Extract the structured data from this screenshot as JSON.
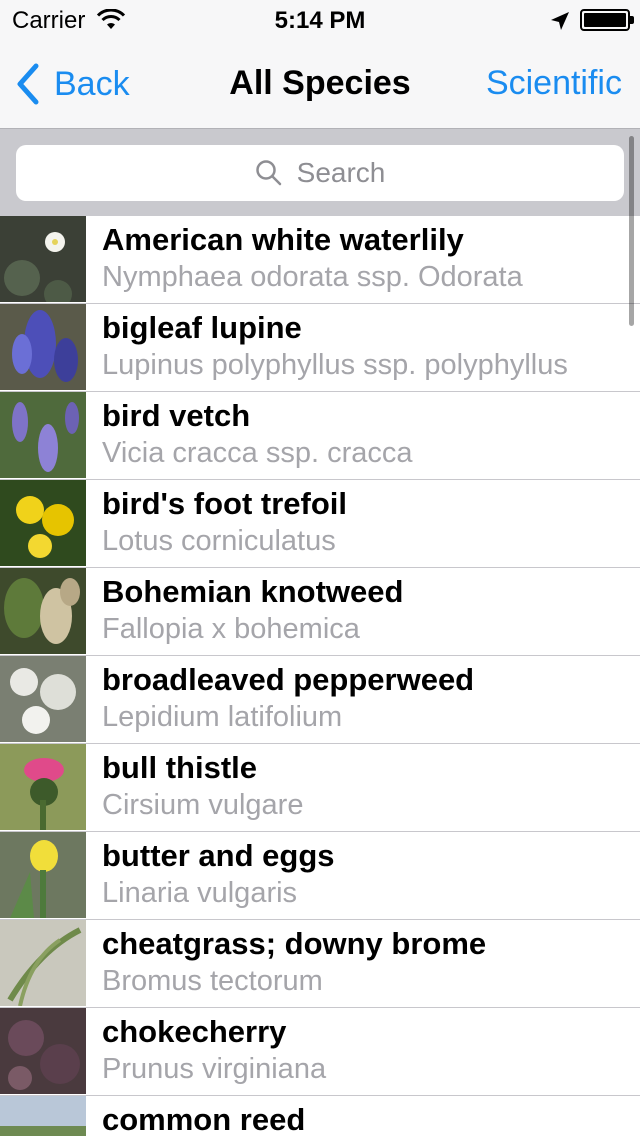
{
  "status": {
    "carrier": "Carrier",
    "time": "5:14 PM",
    "icons": [
      "wifi-icon",
      "location-arrow-icon",
      "battery-icon"
    ]
  },
  "nav": {
    "back_label": "Back",
    "title": "All Species",
    "right_label": "Scientific"
  },
  "search": {
    "placeholder": "Search"
  },
  "colors": {
    "accent": "#1a8cf0",
    "nav_bg": "#f7f7f8",
    "search_bg": "#c9c9ce",
    "secondary_text": "#a5a5aa"
  },
  "species": [
    {
      "common": "American white waterlily",
      "scientific": "Nymphaea odorata ssp. Odorata"
    },
    {
      "common": "bigleaf lupine",
      "scientific": "Lupinus polyphyllus ssp. polyphyllus"
    },
    {
      "common": "bird vetch",
      "scientific": "Vicia cracca ssp. cracca"
    },
    {
      "common": "bird's foot trefoil",
      "scientific": "Lotus corniculatus"
    },
    {
      "common": "Bohemian knotweed",
      "scientific": "Fallopia x bohemica"
    },
    {
      "common": "broadleaved pepperweed",
      "scientific": "Lepidium latifolium"
    },
    {
      "common": "bull thistle",
      "scientific": "Cirsium vulgare"
    },
    {
      "common": "butter and eggs",
      "scientific": "Linaria vulgaris"
    },
    {
      "common": "cheatgrass; downy brome",
      "scientific": "Bromus tectorum"
    },
    {
      "common": "chokecherry",
      "scientific": "Prunus virginiana"
    },
    {
      "common": "common reed",
      "scientific": ""
    }
  ]
}
